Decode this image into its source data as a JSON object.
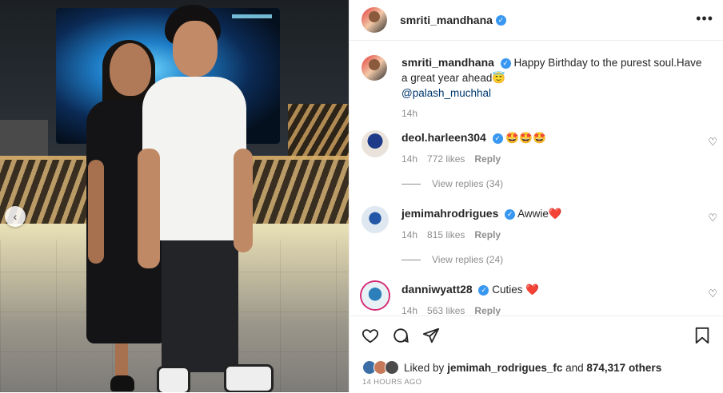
{
  "post": {
    "author": "smriti_mandhana",
    "more_label": "•••",
    "carousel_prev": "‹"
  },
  "caption": {
    "username": "smriti_mandhana",
    "text": "Happy Birthday to the purest soul.Have a great year ahead",
    "emoji": "😇",
    "mention": "@palash_muchhal",
    "time": "14h"
  },
  "comments": [
    {
      "username": "deol.harleen304",
      "text": "🤩🤩🤩",
      "time": "14h",
      "likes": "772 likes",
      "reply": "Reply",
      "view_replies": "View replies (34)"
    },
    {
      "username": "jemimahrodrigues",
      "text": "Awwie❤️",
      "time": "14h",
      "likes": "815 likes",
      "reply": "Reply",
      "view_replies": "View replies (24)"
    },
    {
      "username": "danniwyatt28",
      "text": "Cuties ❤️",
      "time": "14h",
      "likes": "563 likes",
      "reply": "Reply"
    }
  ],
  "likes": {
    "prefix": "Liked by ",
    "user": "jemimah_rodrigues_fc",
    "middle": " and ",
    "count": "874,317 others"
  },
  "posted_ago": "14 HOURS AGO",
  "colors": {
    "verified": "#3897f0",
    "link": "#00376b",
    "muted": "#8e8e8e"
  },
  "icons": [
    "heart-icon",
    "comment-icon",
    "share-icon",
    "bookmark-icon",
    "more-icon",
    "verified-icon",
    "chevron-left-icon"
  ]
}
